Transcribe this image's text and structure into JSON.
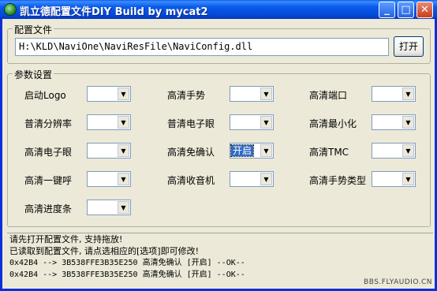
{
  "window": {
    "title": "凯立德配置文件DIY  Build by mycat2",
    "min_symbol": "_",
    "max_symbol": "□",
    "close_symbol": "✕"
  },
  "config_file": {
    "group_label": "配置文件",
    "path": "H:\\KLD\\NaviOne\\NaviResFile\\NaviConfig.dll",
    "open_button": "打开"
  },
  "params": {
    "group_label": "参数设置",
    "items": [
      {
        "label": "启动Logo",
        "value": ""
      },
      {
        "label": "高清手势",
        "value": ""
      },
      {
        "label": "高清端口",
        "value": ""
      },
      {
        "label": "普清分辨率",
        "value": ""
      },
      {
        "label": "普清电子眼",
        "value": ""
      },
      {
        "label": "高清最小化",
        "value": ""
      },
      {
        "label": "高清电子眼",
        "value": ""
      },
      {
        "label": "高清免确认",
        "value": "开启"
      },
      {
        "label": "高清TMC",
        "value": ""
      },
      {
        "label": "高清一键呼",
        "value": ""
      },
      {
        "label": "高清收音机",
        "value": ""
      },
      {
        "label": "高清手势类型",
        "value": ""
      },
      {
        "label": "高清进度条",
        "value": ""
      }
    ]
  },
  "log": {
    "lines": [
      "请先打开配置文件, 支持拖放!",
      "已读取到配置文件, 请点选相应的[选项]即可修改!",
      "0x42B4 --> 3B538FFE3B35E250  高清免确认  [开启]  --OK--",
      "0x42B4 --> 3B538FFE3B35E250  高清免确认  [开启]  --OK--"
    ]
  },
  "watermark": "BBS.FLYAUDIO.CN",
  "colors": {
    "titlebar": "#0A5CEB",
    "window_bg": "#ECE9D8",
    "selection": "#316AC5"
  }
}
